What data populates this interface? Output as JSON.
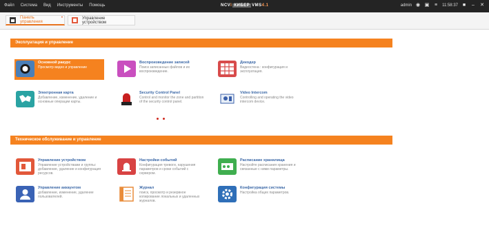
{
  "menu": [
    "Файл",
    "Система",
    "Вид",
    "Инструменты",
    "Помощь"
  ],
  "brand": {
    "p1": "NCV",
    "p2": "I",
    "p3": "КИБЕР",
    "p4": "VMS",
    "p5": "4.1"
  },
  "user": {
    "name": "admin",
    "time": "11:58:37"
  },
  "tabs": [
    {
      "label": "Панель управления",
      "active": true
    },
    {
      "label": "Управление устройством",
      "active": false
    }
  ],
  "sections": [
    {
      "title": "Эксплуатация и управление",
      "items": [
        {
          "title": "Основной ракурс",
          "desc": "Просмотр видео и управление",
          "icon": "camera-icon",
          "color": "#1f6fb2",
          "selected": true
        },
        {
          "title": "Воспроизведение записей",
          "desc": "Поиск записанных файлов и их воспроизведение.",
          "icon": "play-icon",
          "color": "#c94fbf",
          "selected": false
        },
        {
          "title": "Декодер",
          "desc": "Видеостена : конфигурация и эксплуатация.",
          "icon": "grid-icon",
          "color": "#d84b4b",
          "selected": false
        },
        {
          "title": "Электронная карта",
          "desc": "Добавление, изменение, удаление и основные операции карты.",
          "icon": "map-icon",
          "color": "#2aa3a3",
          "selected": false
        },
        {
          "title": "Security Control Panel",
          "desc": "Control and monitor the zone and partition of the security control panel.",
          "icon": "alarm-icon",
          "color": "#c81f1f",
          "selected": false
        },
        {
          "title": "Video Intercom",
          "desc": "Controlling and operating the video intercom device.",
          "icon": "intercom-icon",
          "color": "#3a5faa",
          "selected": false
        }
      ]
    },
    {
      "title": "Техническое обслуживание и управление",
      "items": [
        {
          "title": "Управление устройством",
          "desc": "Управление устройствами и группы: добавление, удаление и конфигурация ресурсов.",
          "icon": "device-icon",
          "color": "#e2583a",
          "selected": false
        },
        {
          "title": "Настройки событий",
          "desc": "Конфигурация тревоги, нарушения параметров и сроки событий с сервером.",
          "icon": "bell-icon",
          "color": "#d84343",
          "selected": false
        },
        {
          "title": "Расписание хранилища",
          "desc": "Настройте расписания хранения и связанные с ними параметры.",
          "icon": "storage-icon",
          "color": "#3fae4f",
          "selected": false
        },
        {
          "title": "Управление аккаунтом",
          "desc": "добавление, изменение, удаление пользователей.",
          "icon": "user-icon",
          "color": "#3a63b5",
          "selected": false
        },
        {
          "title": "Журнал",
          "desc": "поиск, просмотр и резервное копирование локальных и удаленных журналов.",
          "icon": "log-icon",
          "color": "#e98c3a",
          "selected": false
        },
        {
          "title": "Конфигурация системы",
          "desc": "Настройка общих параметров.",
          "icon": "gear-icon",
          "color": "#2f6fb8",
          "selected": false
        }
      ]
    }
  ]
}
